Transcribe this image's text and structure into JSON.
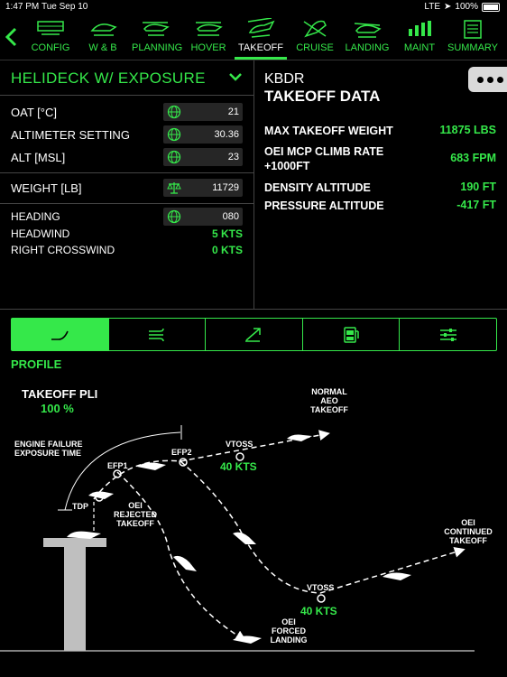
{
  "status": {
    "time": "1:47 PM",
    "date": "Tue Sep 10",
    "carrier": "LTE",
    "battery": "100%"
  },
  "tabs": [
    {
      "label": "CONFIG",
      "icon": "config-icon"
    },
    {
      "label": "W & B",
      "icon": "weight-balance-icon"
    },
    {
      "label": "PLANNING",
      "icon": "planning-icon"
    },
    {
      "label": "HOVER",
      "icon": "hover-icon"
    },
    {
      "label": "TAKEOFF",
      "icon": "takeoff-icon",
      "active": true
    },
    {
      "label": "CRUISE",
      "icon": "cruise-icon"
    },
    {
      "label": "LANDING",
      "icon": "landing-icon"
    },
    {
      "label": "MAINT",
      "icon": "maint-icon"
    },
    {
      "label": "SUMMARY",
      "icon": "summary-icon"
    }
  ],
  "helideck": {
    "title": "HELIDECK W/ EXPOSURE"
  },
  "inputs": {
    "oat": {
      "label": "OAT [°C]",
      "value": "21"
    },
    "altimeter": {
      "label": "ALTIMETER SETTING",
      "value": "30.36"
    },
    "alt": {
      "label": "ALT [MSL]",
      "value": "23"
    },
    "weight": {
      "label": "WEIGHT [LB]",
      "value": "11729"
    },
    "heading": {
      "label": "HEADING",
      "value": "080"
    }
  },
  "wind": {
    "headwind": {
      "label": "HEADWIND",
      "value": "5 KTS"
    },
    "crosswind": {
      "label": "RIGHT CROSSWIND",
      "value": "0 KTS"
    }
  },
  "takeoff_data": {
    "airport": "KBDR",
    "title": "TAKEOFF DATA",
    "rows": [
      {
        "key": "MAX TAKEOFF WEIGHT",
        "value": "11875 LBS"
      },
      {
        "key": "OEI MCP CLIMB RATE +1000FT",
        "value": "683 FPM"
      },
      {
        "key": "DENSITY ALTITUDE",
        "value": "190 FT"
      },
      {
        "key": "PRESSURE ALTITUDE",
        "value": "-417 FT"
      }
    ]
  },
  "segments": [
    "profile-icon",
    "wind-icon",
    "climb-icon",
    "fuel-icon",
    "settings-icon"
  ],
  "profile_label": "PROFILE",
  "diagram": {
    "takeoff_pli_label": "TAKEOFF PLI",
    "takeoff_pli_value": "100 %",
    "normal": [
      "NORMAL",
      "AEO",
      "TAKEOFF"
    ],
    "engine_failure": [
      "ENGINE FAILURE",
      "EXPOSURE TIME"
    ],
    "efp1": "EFP1",
    "efp2": "EFP2",
    "vtoss_top": "VTOSS",
    "vtoss_top_value": "40 KTS",
    "tdp": "TDP",
    "rejected": [
      "OEI",
      "REJECTED",
      "TAKEOFF"
    ],
    "continued": [
      "OEI",
      "CONTINUED",
      "TAKEOFF"
    ],
    "vtoss_bottom": "VTOSS",
    "vtoss_bottom_value": "40 KTS",
    "forced": [
      "OEI",
      "FORCED",
      "LANDING"
    ]
  },
  "colors": {
    "accent": "#35e84a",
    "background": "#000000",
    "input_bg": "#262626"
  }
}
